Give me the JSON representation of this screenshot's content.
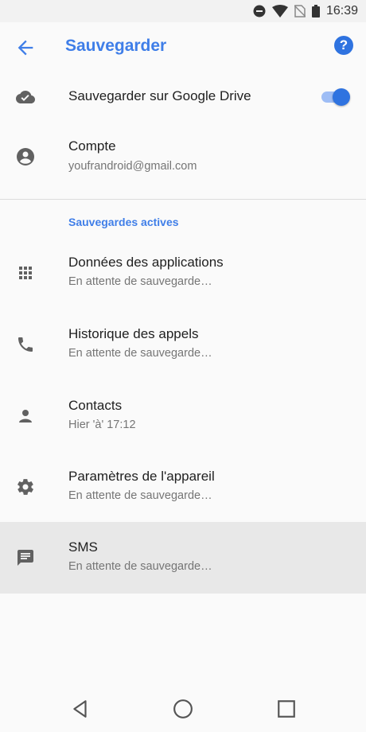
{
  "status_bar": {
    "time": "16:39",
    "icons": [
      "do-not-disturb-icon",
      "wifi-icon",
      "no-sim-icon",
      "battery-icon"
    ]
  },
  "app_bar": {
    "title": "Sauvegarder",
    "back_icon": "arrow-back-icon",
    "help_icon": "help-icon",
    "help_glyph": "?"
  },
  "drive_backup": {
    "label": "Sauvegarder sur Google Drive",
    "icon": "cloud-done-icon",
    "toggle_on": true
  },
  "account": {
    "label": "Compte",
    "email": "youfrandroid@gmail.com",
    "icon": "account-circle-icon"
  },
  "section": {
    "header": "Sauvegardes actives"
  },
  "items": [
    {
      "title": "Données des applications",
      "subtitle": "En attente de sauvegarde…",
      "icon": "apps-grid-icon"
    },
    {
      "title": "Historique des appels",
      "subtitle": "En attente de sauvegarde…",
      "icon": "phone-icon"
    },
    {
      "title": "Contacts",
      "subtitle": "Hier 'à' 17:12",
      "icon": "person-icon"
    },
    {
      "title": "Paramètres de l'appareil",
      "subtitle": "En attente de sauvegarde…",
      "icon": "settings-gear-icon"
    },
    {
      "title": "SMS",
      "subtitle": "En attente de sauvegarde…",
      "icon": "message-icon",
      "highlighted": true
    }
  ],
  "nav_bar": {
    "buttons": [
      "back-triangle-icon",
      "home-circle-icon",
      "recents-square-icon"
    ]
  },
  "colors": {
    "accent": "#3f7ee8",
    "toggle": "#2f73e0"
  }
}
